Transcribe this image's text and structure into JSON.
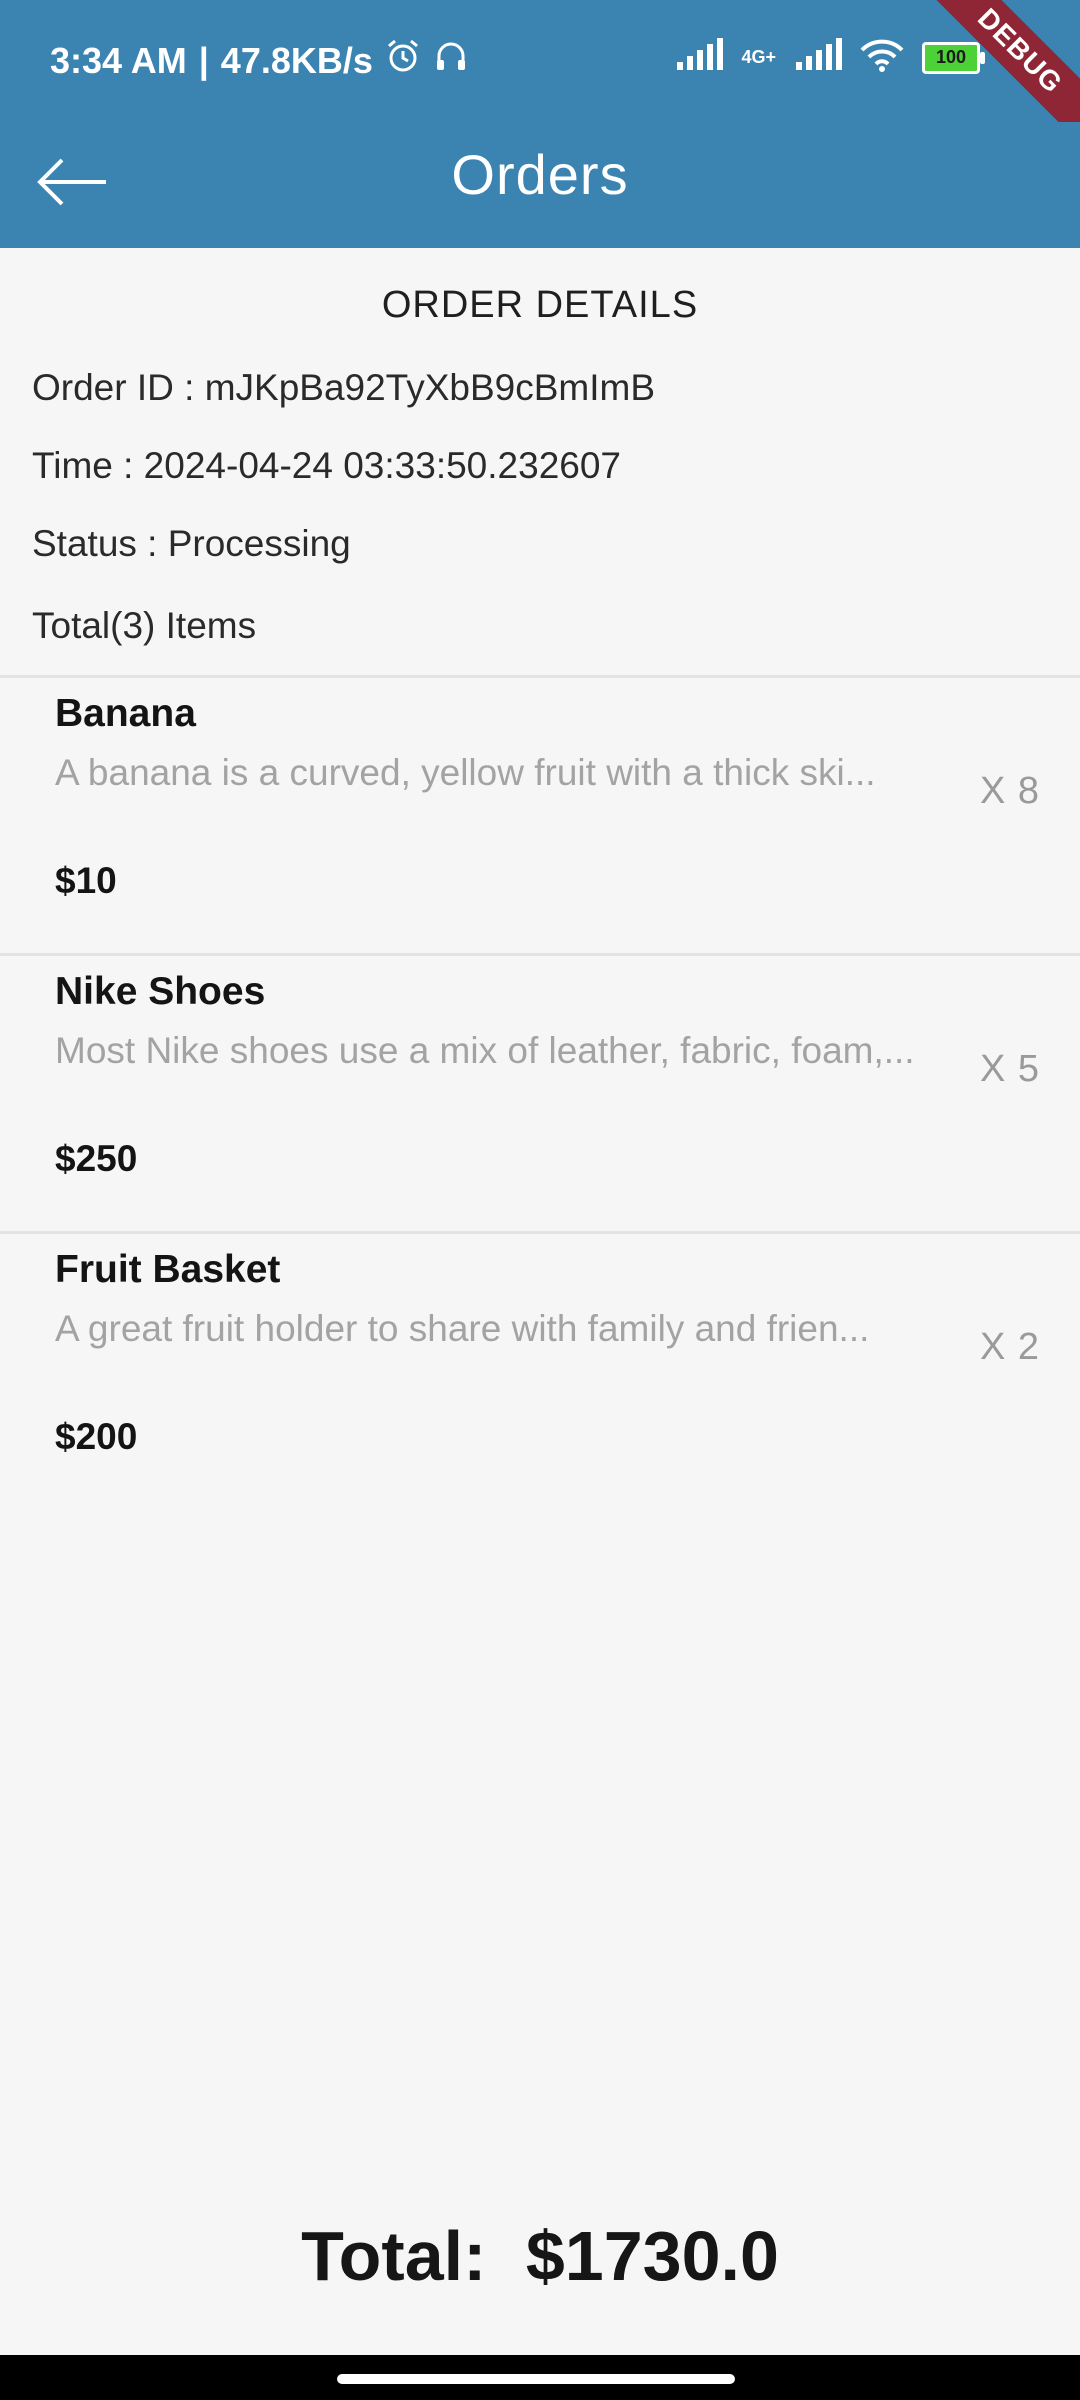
{
  "status": {
    "time": "3:34 AM",
    "speed": "47.8KB/s",
    "network": "4G+",
    "battery": "100"
  },
  "debug": "DEBUG",
  "app_bar": {
    "title": "Orders"
  },
  "order": {
    "heading": "ORDER DETAILS",
    "id_line": "Order ID : mJKpBa92TyXbB9cBmImB",
    "time_line": "Time : 2024-04-24 03:33:50.232607",
    "status_line": "Status : Processing",
    "items_line": "Total(3) Items"
  },
  "items": [
    {
      "name": "Banana",
      "description": "A banana is a curved, yellow fruit with a thick ski...",
      "price": "$10",
      "qty": "X 8"
    },
    {
      "name": "Nike Shoes",
      "description": "Most Nike shoes use a mix of leather, fabric, foam,...",
      "price": "$250",
      "qty": "X 5"
    },
    {
      "name": "Fruit Basket",
      "description": "A great fruit holder to share with family and frien...",
      "price": "$200",
      "qty": "X 2"
    }
  ],
  "total": {
    "label": "Total:",
    "value": "$1730.0"
  },
  "icons": {
    "back": "arrow-left-icon",
    "alarm": "alarm-icon",
    "headset": "headset-icon",
    "signal": "signal-icon",
    "wifi": "wifi-icon"
  }
}
